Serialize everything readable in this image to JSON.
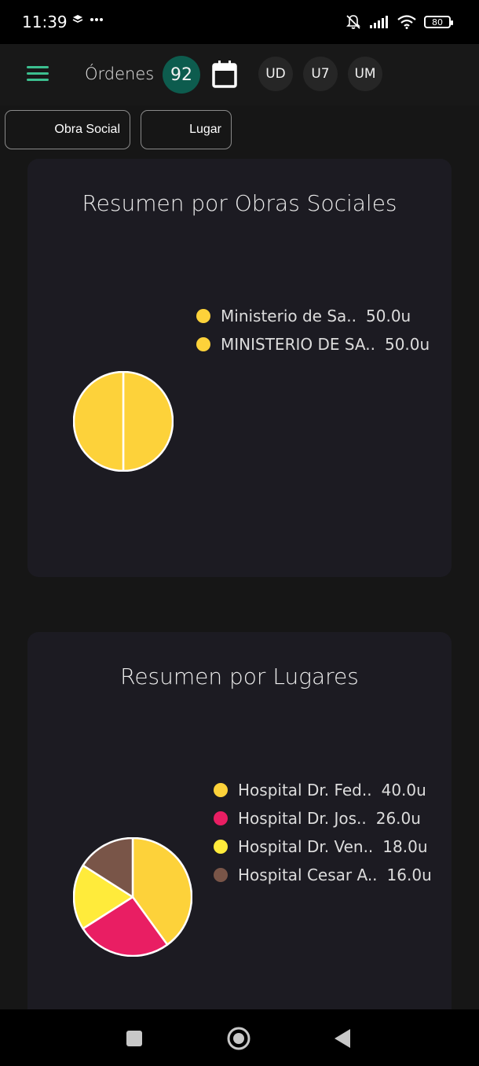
{
  "status_bar": {
    "time": "11:39",
    "battery": "80",
    "icons": [
      "layers-icon",
      "more-dots-icon",
      "bell-off-icon",
      "signal-icon",
      "wifi-icon",
      "battery-icon"
    ]
  },
  "app_bar": {
    "title": "Órdenes",
    "count": "92",
    "units": [
      "UD",
      "U7",
      "UM"
    ],
    "accent": "#3cbf8f",
    "badge_color": "#0d5c4e"
  },
  "filters": {
    "obra_social": "Obra Social",
    "lugar": "Lugar"
  },
  "cards": {
    "obras": {
      "title": "Resumen por Obras Sociales",
      "legend": [
        {
          "label": "Ministerio de Sa..",
          "value": "50.0u",
          "color": "#fdd23a"
        },
        {
          "label": "MINISTERIO DE SA..",
          "value": "50.0u",
          "color": "#fdd23a"
        }
      ]
    },
    "lugares": {
      "title": "Resumen por Lugares",
      "legend": [
        {
          "label": "Hospital Dr. Fed..",
          "value": "40.0u",
          "color": "#fdd23a"
        },
        {
          "label": "Hospital Dr. Jos..",
          "value": "26.0u",
          "color": "#e91e63"
        },
        {
          "label": "Hospital Dr. Ven..",
          "value": "18.0u",
          "color": "#ffeb3b"
        },
        {
          "label": "Hospital Cesar A..",
          "value": "16.0u",
          "color": "#795548"
        }
      ]
    }
  },
  "chart_data": [
    {
      "type": "pie",
      "title": "Resumen por Obras Sociales",
      "categories": [
        "Ministerio de Sa..",
        "MINISTERIO DE SA.."
      ],
      "values": [
        50.0,
        50.0
      ],
      "colors": [
        "#fdd23a",
        "#fdd23a"
      ],
      "legend": "right"
    },
    {
      "type": "pie",
      "title": "Resumen por Lugares",
      "categories": [
        "Hospital Dr. Fed..",
        "Hospital Dr. Jos..",
        "Hospital Dr. Ven..",
        "Hospital Cesar A.."
      ],
      "values": [
        40.0,
        26.0,
        18.0,
        16.0
      ],
      "colors": [
        "#fdd23a",
        "#e91e63",
        "#ffeb3b",
        "#795548"
      ],
      "legend": "right"
    }
  ]
}
